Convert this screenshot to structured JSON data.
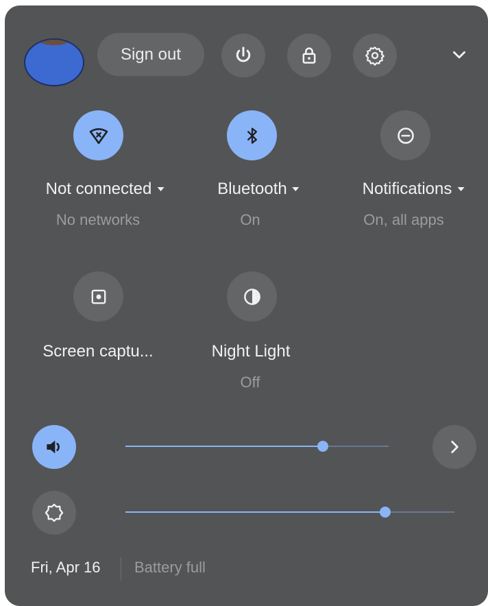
{
  "header": {
    "sign_out_label": "Sign out",
    "icons": [
      "power-icon",
      "lock-icon",
      "settings-icon",
      "collapse-chevron-icon"
    ]
  },
  "tiles": [
    {
      "label": "Not connected",
      "sub": "No networks",
      "icon": "wifi-off-icon",
      "active": true,
      "has_menu": true
    },
    {
      "label": "Bluetooth",
      "sub": "On",
      "icon": "bluetooth-icon",
      "active": true,
      "has_menu": true
    },
    {
      "label": "Notifications",
      "sub": "On, all apps",
      "icon": "do-not-disturb-icon",
      "active": false,
      "has_menu": true
    },
    {
      "label": "Screen captu...",
      "sub": "",
      "icon": "screen-capture-icon",
      "active": false,
      "has_menu": false
    },
    {
      "label": "Night Light",
      "sub": "Off",
      "icon": "night-light-icon",
      "active": false,
      "has_menu": false
    }
  ],
  "sliders": {
    "volume": {
      "icon": "volume-icon",
      "level": 0.75
    },
    "brightness": {
      "icon": "brightness-icon",
      "level": 0.79
    }
  },
  "footer": {
    "date": "Fri, Apr 16",
    "battery": "Battery full"
  },
  "colors": {
    "panel": "#535455",
    "accent": "#8ab4f8",
    "button": "#646566"
  }
}
